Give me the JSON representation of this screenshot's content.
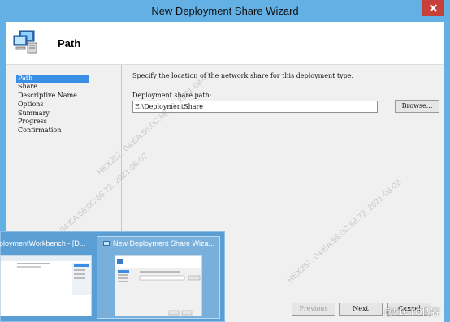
{
  "window": {
    "title": "New Deployment Share Wizard"
  },
  "header": {
    "title": "Path"
  },
  "steps": [
    "Path",
    "Share",
    "Descriptive Name",
    "Options",
    "Summary",
    "Progress",
    "Confirmation"
  ],
  "content": {
    "instruction": "Specify the location of the network share for this deployment type.",
    "path_label": "Deployment share path:",
    "path_value": "E:\\DeploymentShare",
    "browse_label": "Browse..."
  },
  "buttons": {
    "previous": "Previous",
    "next": "Next",
    "cancel": "Cancel"
  },
  "taskbar": {
    "thumb1_title": "ploymentWorkbench - [D...",
    "thumb2_title": "New Deployment Share Wiza..."
  },
  "watermarks": [
    "HEX257, 04:EA:56:0C:68:72, 2021-08-02"
  ],
  "logo_text": "@51CTO博客"
}
